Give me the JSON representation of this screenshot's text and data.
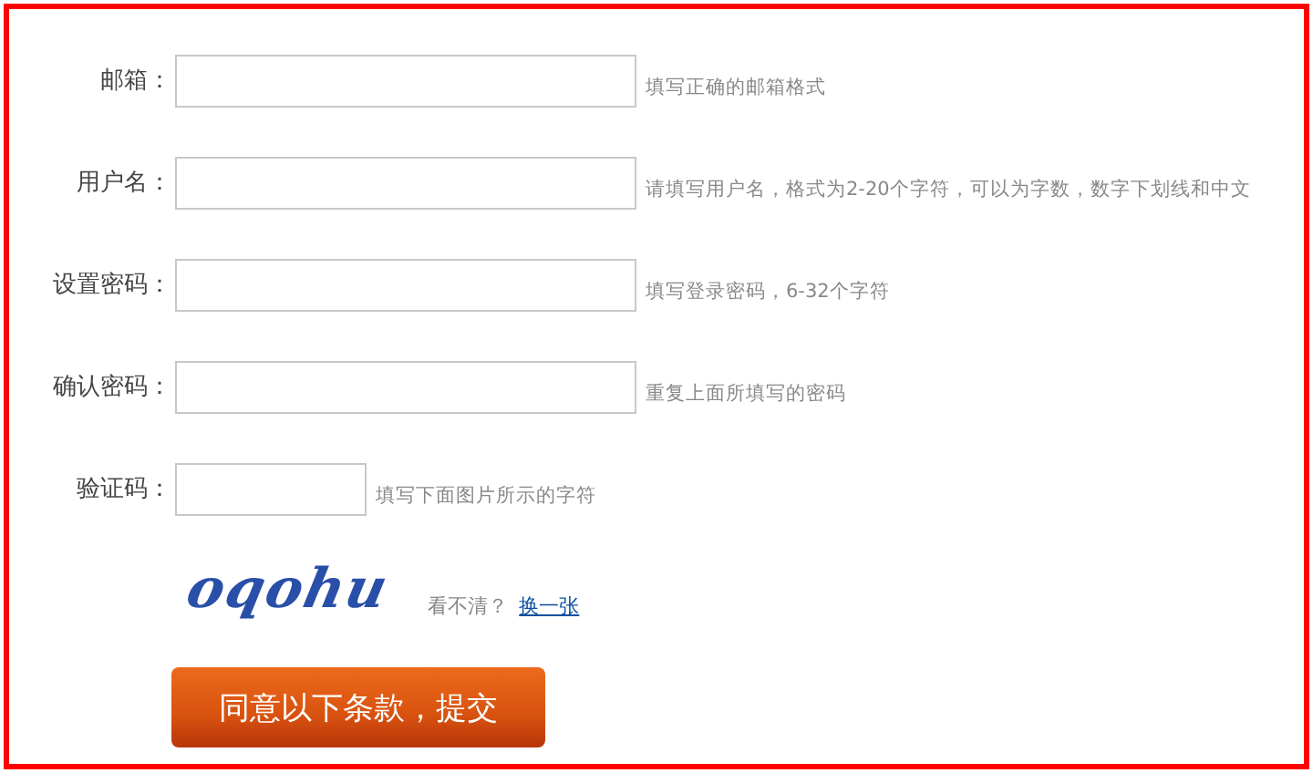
{
  "fields": [
    {
      "label": "邮箱：",
      "hint": "填写正确的邮箱格式",
      "kind": "wide"
    },
    {
      "label": "用户名：",
      "hint": "请填写用户名，格式为2-20个字符，可以为字数，数字下划线和中文",
      "kind": "wide"
    },
    {
      "label": "设置密码：",
      "hint": "填写登录密码，6-32个字符",
      "kind": "wide"
    },
    {
      "label": "确认密码：",
      "hint": "重复上面所填写的密码",
      "kind": "wide"
    },
    {
      "label": "验证码：",
      "hint": "填写下面图片所示的字符",
      "kind": "short"
    }
  ],
  "captcha": {
    "text": "oqohu",
    "prompt": "看不清？",
    "refresh_link": "换一张"
  },
  "submit_button": "同意以下条款，提交"
}
